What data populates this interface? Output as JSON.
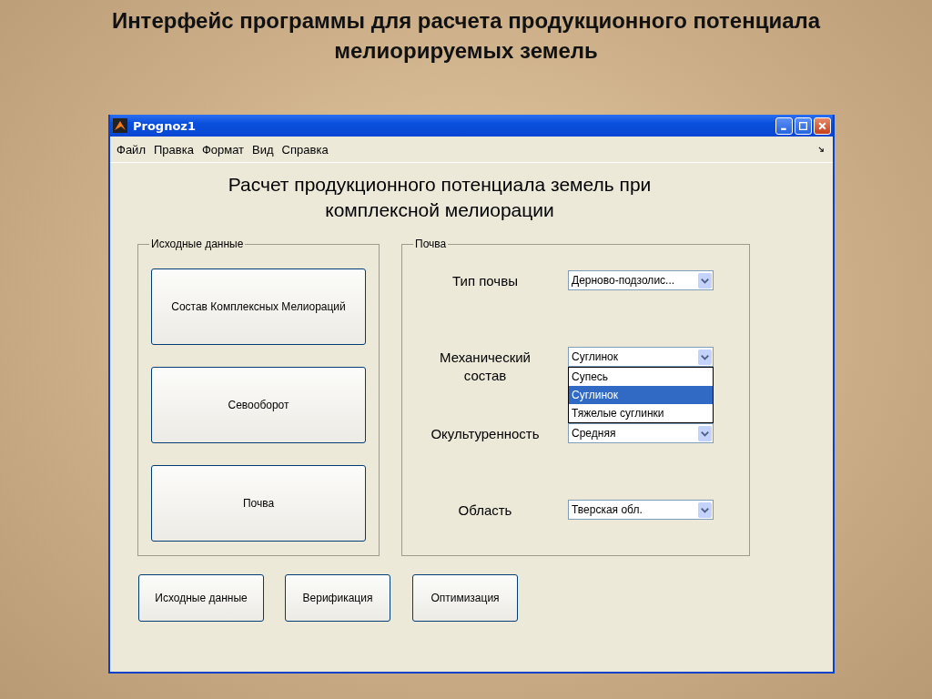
{
  "slide_title": "Интерфейс программы для расчета продукционного потенциала мелиорируемых земель",
  "window": {
    "title": "Prognoz1"
  },
  "menu": [
    "Файл",
    "Правка",
    "Формат",
    "Вид",
    "Справка"
  ],
  "heading": "Расчет продукционного потенциала земель при комплексной мелиорации",
  "input_group": {
    "title": "Исходные данные",
    "buttons": [
      "Состав Комплексных Мелиораций",
      "Севооборот",
      "Почва"
    ]
  },
  "soil_group": {
    "title": "Почва",
    "rows": [
      {
        "label": "Тип почвы",
        "value": "Дерново-подзолис...",
        "expanded": false
      },
      {
        "label": "Механический состав",
        "value": "Суглинок",
        "expanded": true,
        "options": [
          {
            "label": "Супесь",
            "selected": false
          },
          {
            "label": "Суглинок",
            "selected": true
          },
          {
            "label": "Тяжелые суглинки",
            "selected": false
          }
        ]
      },
      {
        "label": "Окультуренность",
        "value": "Средняя",
        "expanded": false
      },
      {
        "label": "Область",
        "value": "Тверская обл.",
        "expanded": false
      }
    ]
  },
  "bottom_buttons": [
    "Исходные данные",
    "Верификация",
    "Оптимизация"
  ]
}
